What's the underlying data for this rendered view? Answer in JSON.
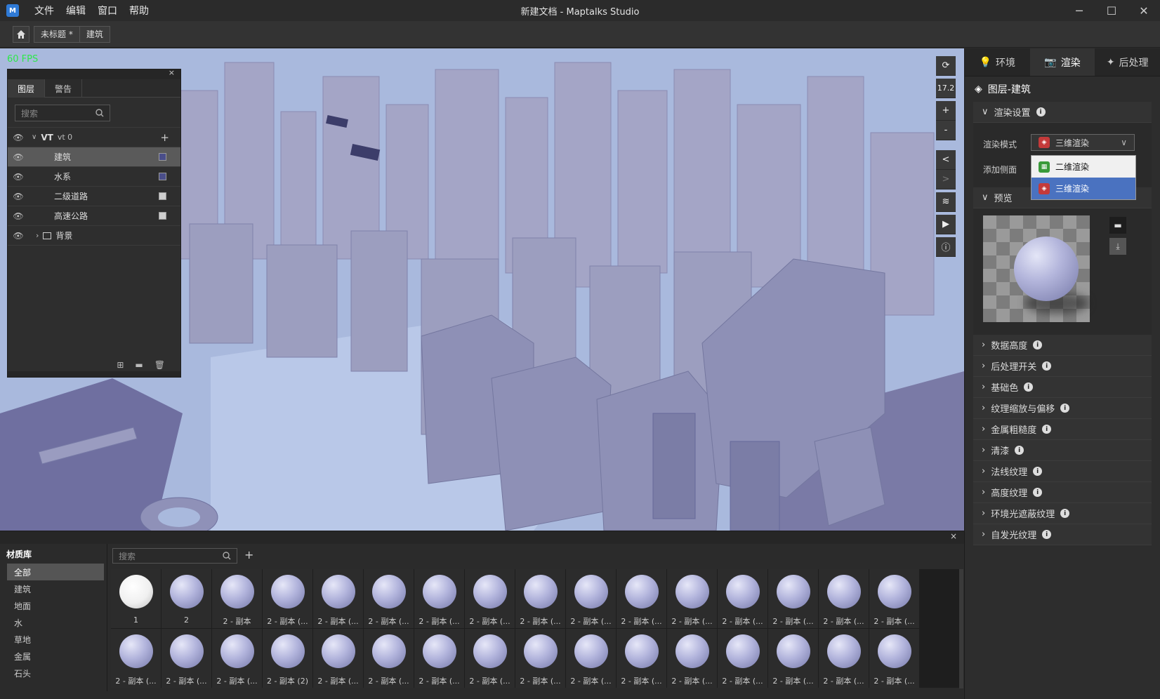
{
  "app": {
    "title": "新建文档 - Maptalks Studio",
    "logo": "M",
    "fps": "60 FPS"
  },
  "menu": [
    "文件",
    "编辑",
    "窗口",
    "帮助"
  ],
  "breadcrumb": [
    "未标题 *",
    "建筑"
  ],
  "layers_panel": {
    "close": "×",
    "tabs": [
      "图层",
      "警告"
    ],
    "search_placeholder": "搜索",
    "group": {
      "name": "VT",
      "sub": "vt 0"
    },
    "items": [
      {
        "label": "建筑",
        "color": "#4a4e8a",
        "selected": true
      },
      {
        "label": "水系",
        "color": "#4a4e8a"
      },
      {
        "label": "二级道路",
        "color": "#cfcfcf"
      },
      {
        "label": "高速公路",
        "color": "#cfcfcf"
      }
    ],
    "background": "背景"
  },
  "map_tools": {
    "zoom": "17.2",
    "plus": "+",
    "minus": "-",
    "prev": "<",
    "next": ">"
  },
  "right_panel": {
    "tabs": [
      "环境",
      "渲染",
      "后处理"
    ],
    "header": "图层-建筑",
    "render_settings": {
      "title": "渲染设置",
      "mode_label": "渲染模式",
      "mode_value": "三维渲染",
      "side_label": "添加侧面",
      "options": [
        "二维渲染",
        "三维渲染"
      ]
    },
    "preview_title": "预览",
    "sections": [
      "数据高度",
      "后处理开关",
      "基础色",
      "纹理缩放与偏移",
      "金属粗糙度",
      "清漆",
      "法线纹理",
      "高度纹理",
      "环境光遮蔽纹理",
      "自发光纹理"
    ]
  },
  "material_library": {
    "close": "×",
    "title": "材质库",
    "categories": [
      "全部",
      "建筑",
      "地面",
      "水",
      "草地",
      "金属",
      "石头"
    ],
    "search_placeholder": "搜索",
    "add": "+",
    "items": [
      "1",
      "2",
      "2 - 副本",
      "2 - 副本 (...",
      "2 - 副本 (...",
      "2 - 副本 (...",
      "2 - 副本 (...",
      "2 - 副本 (...",
      "2 - 副本 (...",
      "2 - 副本 (...",
      "2 - 副本 (...",
      "2 - 副本 (...",
      "2 - 副本 (...",
      "2 - 副本 (...",
      "2 - 副本 (...",
      "2 - 副本 (...",
      "2 - 副本 (...",
      "2 - 副本 (...",
      "2 - 副本 (...",
      "2 - 副本 (2)",
      "2 - 副本 (...",
      "2 - 副本 (...",
      "2 - 副本 (...",
      "2 - 副本 (...",
      "2 - 副本 (...",
      "2 - 副本 (...",
      "2 - 副本 (...",
      "2 - 副本 (...",
      "2 - 副本 (...",
      "2 - 副本 (...",
      "2 - 副本 (...",
      "2 - 副本 (..."
    ]
  }
}
